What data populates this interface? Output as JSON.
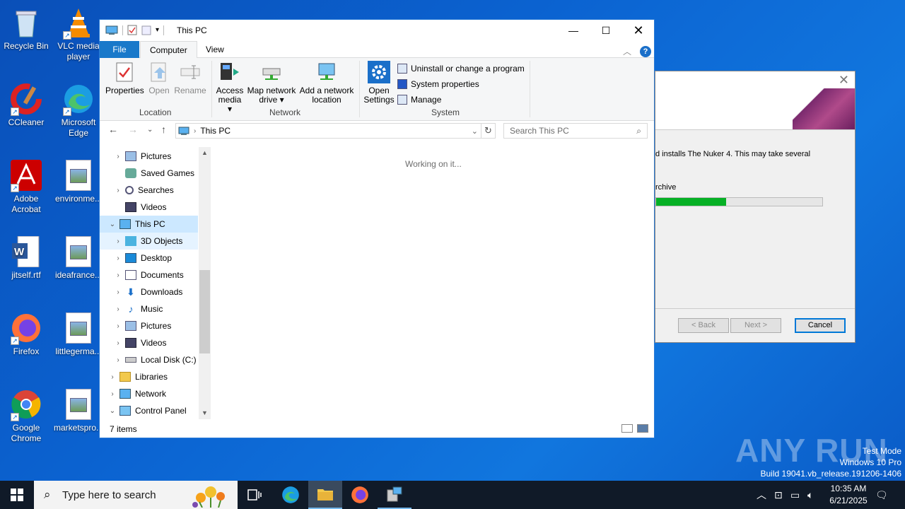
{
  "desktop": {
    "icons": [
      {
        "label": "Recycle Bin"
      },
      {
        "label": "VLC media player"
      },
      {
        "label": "CCleaner"
      },
      {
        "label": "Microsoft Edge"
      },
      {
        "label": "Adobe Acrobat"
      },
      {
        "label": "environme..."
      },
      {
        "label": "jitself.rtf"
      },
      {
        "label": "ideafrance..."
      },
      {
        "label": "Firefox"
      },
      {
        "label": "littlegerma..."
      },
      {
        "label": "Google Chrome"
      },
      {
        "label": "marketspro..."
      }
    ]
  },
  "installer": {
    "line1": "d installs The Nuker 4.  This may take several",
    "line2": "rchive",
    "progress": 0.42,
    "back_label": "< Back",
    "next_label": "Next >",
    "cancel_label": "Cancel",
    "close_glyph": "✕"
  },
  "explorer": {
    "title": "This PC",
    "tabs": {
      "file": "File",
      "computer": "Computer",
      "view": "View"
    },
    "ribbon": {
      "properties": "Properties",
      "open": "Open",
      "rename": "Rename",
      "access_media": "Access media",
      "map_network_drive": "Map network drive",
      "add_network_location": "Add a network location",
      "open_settings": "Open Settings",
      "uninstall": "Uninstall or change a program",
      "system_properties": "System properties",
      "manage": "Manage",
      "group_location": "Location",
      "group_network": "Network",
      "group_system": "System"
    },
    "address": {
      "path": "This PC",
      "search_placeholder": "Search This PC"
    },
    "nav": [
      {
        "label": "Pictures"
      },
      {
        "label": "Saved Games"
      },
      {
        "label": "Searches"
      },
      {
        "label": "Videos"
      },
      {
        "label": "This PC"
      },
      {
        "label": "3D Objects"
      },
      {
        "label": "Desktop"
      },
      {
        "label": "Documents"
      },
      {
        "label": "Downloads"
      },
      {
        "label": "Music"
      },
      {
        "label": "Pictures"
      },
      {
        "label": "Videos"
      },
      {
        "label": "Local Disk (C:)"
      },
      {
        "label": "Libraries"
      },
      {
        "label": "Network"
      },
      {
        "label": "Control Panel"
      }
    ],
    "content_message": "Working on it...",
    "status": "7 items"
  },
  "watermark": {
    "brand": "ANY RUN",
    "line1": "Test Mode",
    "line2": "Windows 10 Pro",
    "line3": "Build 19041.vb_release.191206-1406"
  },
  "taskbar": {
    "search_placeholder": "Type here to search",
    "time": "10:35 AM",
    "date": "6/21/2025"
  },
  "colors": {
    "accent": "#1979ca",
    "selection": "#cce8ff",
    "progress": "#06b025"
  }
}
